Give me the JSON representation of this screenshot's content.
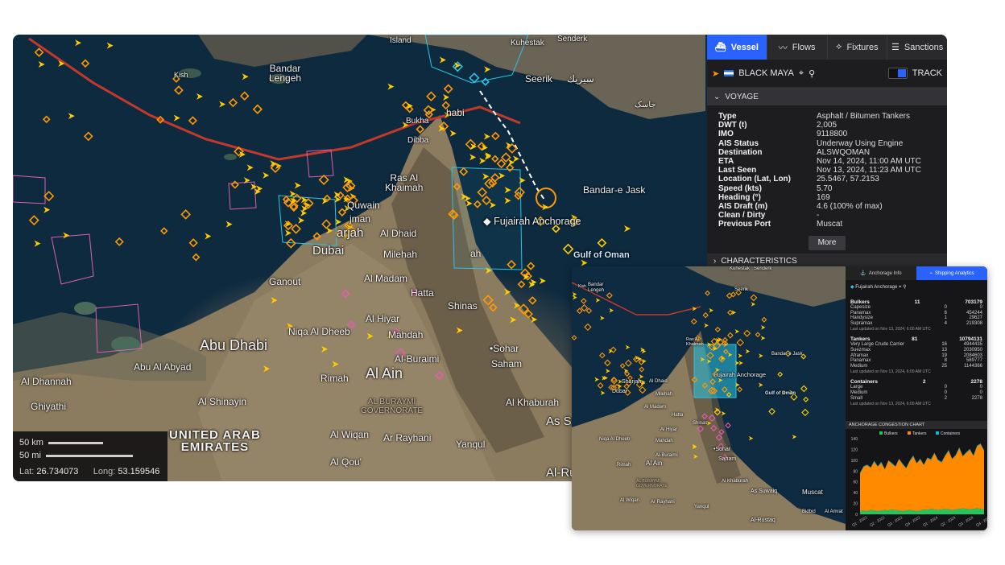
{
  "map": {
    "labels": {
      "island": "Island",
      "kuhestak": "Kuhestak",
      "senderk": "Senderk",
      "bandar_lengeh": "Bandar\nLengeh",
      "kish": "Kish",
      "seerik": "Seerik",
      "seerik_ar": "سيريك",
      "khasab": "habi",
      "bukha": "Bukha",
      "dibba": "Dibba",
      "ras_al_khaimah": "Ras Al\nKhaimah",
      "umm_al_quwain": "Quwain",
      "ajman": "jman",
      "sharjah": "arjah",
      "dubai": "Dubai",
      "al_dhaid": "Al Dhaid",
      "milehah": "Milehah",
      "fujairah_anchorage": "Fujairah Anchorage",
      "fujairah": "ah",
      "bandar_e_jask": "Bandar-e Jask",
      "jask_fa": "جاسک",
      "gulf_of_oman": "Gulf of Oman",
      "ganout": "Ganout",
      "al_madam": "Al Madam",
      "hatta": "Hatta",
      "shinas": "Shinas",
      "al_hiyar": "Al Hiyar",
      "niqa_al_dheeb": "Niqa Al Dheeb",
      "mahdah": "Mahdah",
      "sohar": "•Sohar",
      "abu_dhabi": "Abu Dhabi",
      "abu_al_abyad": "Abu Al Abyad",
      "al_buraimi": "Al-Buraimi",
      "saham": "Saham",
      "al_ain": "Al Ain",
      "rimah": "Rimah",
      "al_dhannah": "Al Dhannah",
      "ghiyathi": "Ghiyathi",
      "al_shinayin": "Al Shinayin",
      "al_buraymi_gov": "AL BURAYMI\nGOVERNORATE",
      "al_khaburah": "Al Khaburah",
      "uae": "UNITED ARAB\nEMIRATES",
      "al_wiqan": "Al Wiqan",
      "ar_rayhani": "Ar Rayhani",
      "yanqul": "Yanqul",
      "as_su": "As Su",
      "al_qou": "Al Qou'",
      "al_ru": "Al-Ru"
    },
    "scale": {
      "km": "50 km",
      "mi": "50 mi",
      "lat_label": "Lat:",
      "lat": "26.734073",
      "long_label": "Long:",
      "long": "53.159546"
    }
  },
  "panel": {
    "tabs": [
      {
        "label": "Vessel",
        "icon": "ship-icon"
      },
      {
        "label": "Flows",
        "icon": "flows-icon"
      },
      {
        "label": "Fixtures",
        "icon": "fixtures-icon"
      },
      {
        "label": "Sanctions",
        "icon": "sanctions-icon"
      }
    ],
    "vessel_name": "BLACK MAYA",
    "track_label": "TRACK",
    "voyage_header": "VOYAGE",
    "fields": [
      {
        "k": "Type",
        "v": "Asphalt / Bitumen Tankers"
      },
      {
        "k": "DWT (t)",
        "v": "2,005"
      },
      {
        "k": "IMO",
        "v": "9118800"
      },
      {
        "k": "AIS Status",
        "v": "Underway Using Engine"
      },
      {
        "k": "Destination",
        "v": "ALSWQOMAN"
      },
      {
        "k": "ETA",
        "v": "Nov 14, 2024, 11:00 AM UTC"
      },
      {
        "k": "Last Seen",
        "v": "Nov 13, 2024, 11:23 AM UTC"
      },
      {
        "k": "Location (Lat, Lon)",
        "v": "25.5467, 57.2153"
      },
      {
        "k": "Speed (kts)",
        "v": "5.70"
      },
      {
        "k": "Heading (°)",
        "v": "169"
      },
      {
        "k": "AIS Draft (m)",
        "v": "4.6 (100% of max)"
      },
      {
        "k": "Clean / Dirty",
        "v": "-"
      },
      {
        "k": "Previous Port",
        "v": "Muscat"
      }
    ],
    "more_label": "More",
    "characteristics_header": "CHARACTERISTICS"
  },
  "inset": {
    "tabs": [
      "Anchorage Info",
      "Shipping Analytics"
    ],
    "anchorage_name": "Fujairah Anchorage",
    "map_labels": {
      "kuhestak": "Kuhestak",
      "senderk": "Senderk",
      "seerik": "Seerik",
      "bandar_e_jask": "Bandar-e Jask",
      "gulf_of_oman": "Gulf of Oman",
      "fujairah_anchorage": "Fujairah Anchorage",
      "shinas": "Shinas",
      "sohar": "•Sohar",
      "saham": "Saham",
      "al_ain": "Al Ain",
      "niqa": "Niqa Al Dheeb",
      "mahdah": "Mahdah",
      "al_buraimi": "Al-Buraimi",
      "rimah": "Rimah",
      "al_khaburah": "Al Khaburah",
      "as_suwaiq": "As Suwaiq",
      "muscat": "Muscat",
      "al_rustaq": "Al-Rustaq",
      "bidbid": "Bidbid",
      "al_amrat": "Al Amrat",
      "ar_rayhani": "Ar Rayhani",
      "al_wiqan": "Al Wiqan",
      "yanqul": "Yanqul",
      "gov": "AL BURAYMI\nGOVERNORATE",
      "dubai": "Dubai",
      "sharjah": "Sharjah",
      "al_dhaid": "Al Dhaid",
      "milehah": "Milehah",
      "al_madam": "Al Madam",
      "hatta": "Hatta",
      "al_hiyar": "Al Hiyar",
      "al_ain2": "Al Ain",
      "bandar": "Bandar\nLengeh",
      "kish": "Kish",
      "ras": "Ras Al\nKhaimah"
    },
    "groups": [
      {
        "name": "Bulkers",
        "count": "11",
        "dwt": "703179",
        "rows": [
          [
            "Capesize",
            "0",
            "0"
          ],
          [
            "Panamax",
            "6",
            "454244"
          ],
          [
            "Handysize",
            "1",
            "29627"
          ],
          [
            "Supramax",
            "4",
            "219308"
          ]
        ],
        "updated": "Last updated on Nov 13, 2024, 6:00 AM UTC"
      },
      {
        "name": "Tankers",
        "count": "81",
        "dwt": "10794131",
        "rows": [
          [
            "Very Large Crude Carrier",
            "16",
            "4944435"
          ],
          [
            "Suezmax",
            "13",
            "2030950"
          ],
          [
            "Aframax",
            "19",
            "2084603"
          ],
          [
            "Panamax",
            "8",
            "589777"
          ],
          [
            "Medium",
            "25",
            "1144366"
          ]
        ],
        "updated": "Last updated on Nov 13, 2024, 6:00 AM UTC"
      },
      {
        "name": "Containers",
        "count": "2",
        "dwt": "2278",
        "rows": [
          [
            "Large",
            "0",
            "0"
          ],
          [
            "Medium",
            "0",
            "0"
          ],
          [
            "Small",
            "2",
            "2278"
          ]
        ],
        "updated": "Last updated on Nov 13, 2024, 6:00 AM UTC"
      }
    ],
    "chart_title": "ANCHORAGE CONGESTION CHART"
  },
  "chart_data": {
    "type": "area",
    "title": "ANCHORAGE CONGESTION CHART",
    "series": [
      {
        "name": "Bulkers",
        "color": "#22c55e",
        "values": [
          6,
          7,
          6,
          8,
          7,
          6,
          7,
          8,
          7,
          9,
          8,
          7,
          6,
          7,
          8,
          7,
          6,
          7,
          9,
          8,
          10,
          9,
          8,
          9,
          10,
          9,
          8,
          9,
          10,
          11,
          10,
          9,
          10,
          11,
          10,
          9
        ]
      },
      {
        "name": "Tankers",
        "color": "#ff8a00",
        "values": [
          70,
          80,
          85,
          78,
          90,
          82,
          88,
          75,
          92,
          84,
          80,
          95,
          86,
          78,
          90,
          100,
          88,
          94,
          82,
          96,
          90,
          104,
          92,
          86,
          98,
          108,
          94,
          100,
          112,
          96,
          104,
          110,
          98,
          114,
          120,
          108
        ]
      },
      {
        "name": "Containers",
        "color": "#14b8d4",
        "values": [
          1,
          2,
          1,
          1,
          2,
          1,
          2,
          1,
          1,
          2,
          1,
          1,
          2,
          1,
          1,
          2,
          1,
          2,
          1,
          1,
          2,
          1,
          1,
          2,
          1,
          2,
          1,
          1,
          2,
          1,
          1,
          2,
          1,
          2,
          1,
          2
        ]
      }
    ],
    "x_labels": [
      "Q1 - 2023",
      "Q2 - 2023",
      "Q3 - 2023",
      "Q4 - 2023",
      "Q1 - 2024",
      "Q2 - 2024",
      "Q3 - 2024",
      "Q4 - 2024"
    ],
    "y_ticks": [
      "0",
      "20",
      "40",
      "60",
      "80",
      "100",
      "120",
      "140"
    ],
    "ylim": [
      0,
      140
    ],
    "stacked": true,
    "legend_position": "top"
  },
  "colors": {
    "accent": "#2962ff",
    "vessel_orange": "#ff9900",
    "route_red": "#c0392b",
    "zone_cyan": "#29c5e6",
    "zone_pink": "#e05fb0"
  }
}
